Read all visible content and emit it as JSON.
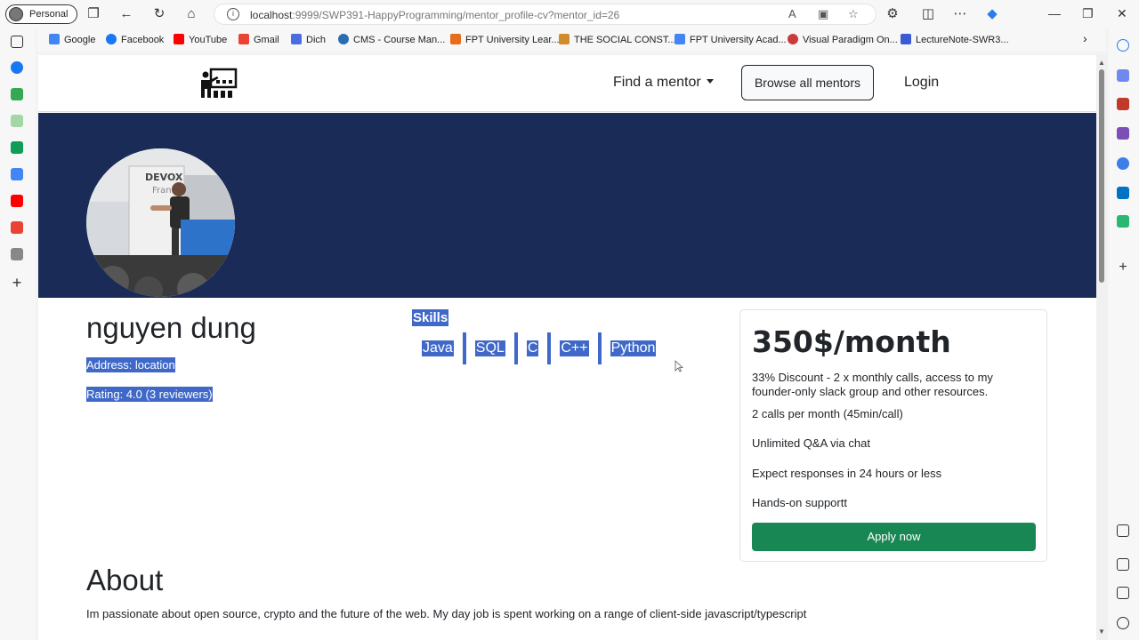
{
  "browser": {
    "profile_label": "Personal",
    "url_host": "localhost",
    "url_rest": ":9999/SWP391-HappyProgramming/mentor_profile-cv?mentor_id=26"
  },
  "bookmarks": [
    {
      "label": "Google",
      "color": "#4285f4"
    },
    {
      "label": "Facebook",
      "color": "#1877f2"
    },
    {
      "label": "YouTube",
      "color": "#ff0000"
    },
    {
      "label": "Gmail",
      "color": "#ea4335"
    },
    {
      "label": "Dich",
      "color": "#4a6ee0"
    },
    {
      "label": "CMS - Course Man...",
      "color": "#2a6db0"
    },
    {
      "label": "FPT University Lear...",
      "color": "#e86c1a"
    },
    {
      "label": "THE SOCIAL CONST...",
      "color": "#d08b2a"
    },
    {
      "label": "FPT University Acad...",
      "color": "#4285f4"
    },
    {
      "label": "Visual Paradigm On...",
      "color": "#c93a3a"
    },
    {
      "label": "LectureNote-SWR3...",
      "color": "#3b5bd6"
    }
  ],
  "nav": {
    "find_mentor": "Find a mentor",
    "browse_all": "Browse all mentors",
    "login": "Login"
  },
  "profile": {
    "name": "nguyen dung",
    "address": "Address: location",
    "rating": "Rating: 4.0 (3 reviewers)",
    "skills_title": "Skills",
    "skills": [
      "Java",
      "SQL",
      "C",
      "C++",
      "Python"
    ]
  },
  "pricing": {
    "price": "350$/month",
    "description": "33% Discount - 2 x monthly calls, access to my founder-only slack group and other resources.",
    "features": [
      "2 calls per month (45min/call)",
      "Unlimited Q&A via chat",
      "Expect responses in 24 hours or less",
      "Hands-on supportt"
    ],
    "apply": "Apply now"
  },
  "about": {
    "title": "About",
    "text": "Im passionate about open source, crypto and the future of the web. My day job is spent working on a range of client-side javascript/typescript"
  },
  "colors": {
    "banner": "#192b56",
    "highlight": "#3f68c8",
    "apply": "#198754"
  }
}
